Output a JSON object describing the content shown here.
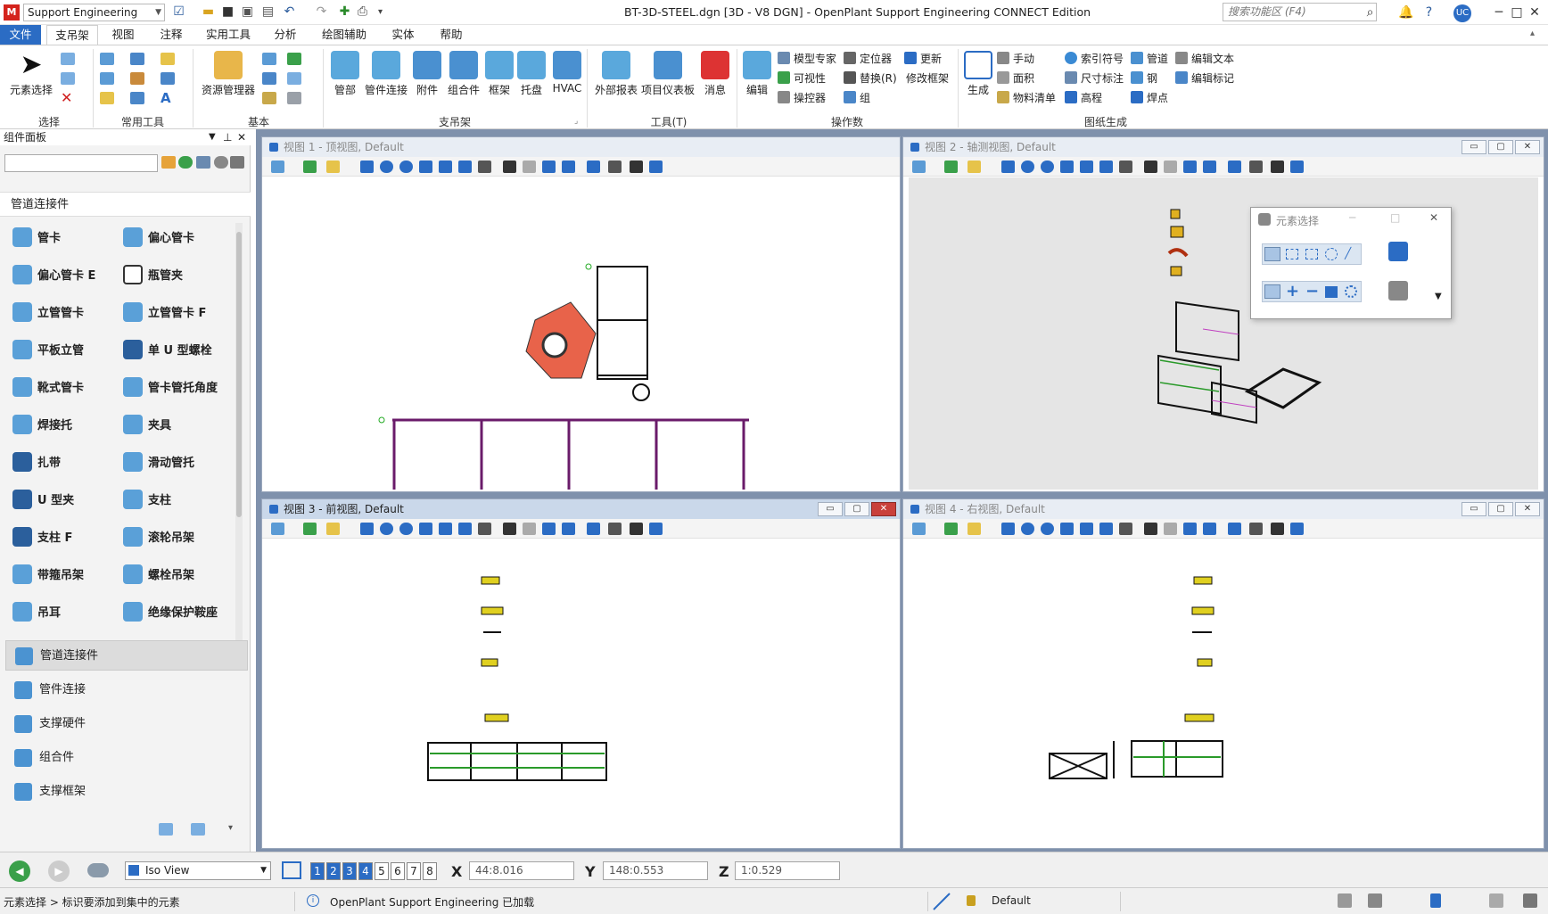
{
  "titlebar": {
    "workflow": "Support Engineering",
    "title": "BT-3D-STEEL.dgn [3D - V8 DGN] - OpenPlant Support Engineering CONNECT Edition",
    "search_placeholder": "搜索功能区 (F4)",
    "user": "UC"
  },
  "tabs": [
    "文件",
    "支吊架",
    "视图",
    "注释",
    "实用工具",
    "分析",
    "绘图辅助",
    "实体",
    "帮助"
  ],
  "ribbon": {
    "select": {
      "label": "元素选择",
      "group": "选择"
    },
    "common": {
      "group": "常用工具"
    },
    "basic": {
      "big": "资源管理器",
      "group": "基本"
    },
    "support": {
      "buttons": [
        "管部",
        "管件连接",
        "附件",
        "组合件",
        "框架",
        "托盘",
        "HVAC"
      ],
      "group": "支吊架"
    },
    "tools": {
      "buttons": [
        "外部报表",
        "项目仪表板",
        "消息"
      ],
      "group": "工具(T)"
    },
    "ops": {
      "edit": "编辑",
      "items": [
        "模型专家",
        "可视性",
        "操控器",
        "定位器",
        "替换(R)",
        "组",
        "更新",
        "修改框架"
      ],
      "group": "操作数"
    },
    "drawing": {
      "gen": "生成",
      "items": [
        "手动",
        "面积",
        "物料清单",
        "索引符号",
        "尺寸标注",
        "高程",
        "管道",
        "钢",
        "焊点",
        "编辑文本",
        "编辑标记"
      ],
      "group": "图纸生成"
    }
  },
  "panel": {
    "header": "组件面板",
    "category": "管道连接件",
    "items": [
      [
        "管卡",
        "偏心管卡"
      ],
      [
        "偏心管卡 E",
        "瓶管夹"
      ],
      [
        "立管管卡",
        "立管管卡 F"
      ],
      [
        "平板立管",
        "单 U 型螺栓"
      ],
      [
        "靴式管卡",
        "管卡管托角度"
      ],
      [
        "焊接托",
        "夹具"
      ],
      [
        "扎带",
        "滑动管托"
      ],
      [
        "U 型夹",
        "支柱"
      ],
      [
        "支柱 F",
        "滚轮吊架"
      ],
      [
        "带箍吊架",
        "螺栓吊架"
      ],
      [
        "吊耳",
        "绝缘保护鞍座"
      ]
    ],
    "categories": [
      "管道连接件",
      "管件连接",
      "支撑硬件",
      "组合件",
      "支撑框架"
    ]
  },
  "views": {
    "v1": "视图 1 - 顶视图, Default",
    "v2": "视图 2 - 轴测视图, Default",
    "v3": "视图 3 - 前视图, Default",
    "v4": "视图 4 - 右视图, Default"
  },
  "dialog": {
    "title": "元素选择"
  },
  "status": {
    "view_combo": "Iso View",
    "view_numbers": [
      "1",
      "2",
      "3",
      "4",
      "5",
      "6",
      "7",
      "8"
    ],
    "x_label": "X",
    "x_value": "44:8.016",
    "y_label": "Y",
    "y_value": "148:0.553",
    "z_label": "Z",
    "z_value": "1:0.529",
    "prompt": "元素选择 > 标识要添加到集中的元素",
    "message": "OpenPlant Support Engineering 已加载",
    "level": "Default"
  },
  "colors": {
    "accent": "#2b6cc4",
    "active_view_title": "#cad8ea",
    "close_red": "#c9403b"
  }
}
